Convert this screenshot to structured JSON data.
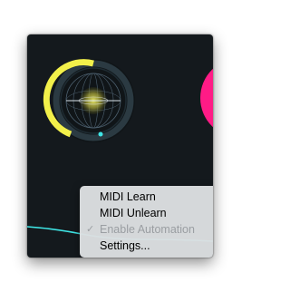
{
  "context_menu": {
    "items": [
      {
        "label": "MIDI Learn",
        "enabled": true,
        "checked": false
      },
      {
        "label": "MIDI Unlearn",
        "enabled": true,
        "checked": false
      },
      {
        "label": "Enable Automation",
        "enabled": false,
        "checked": true
      },
      {
        "label": "Settings...",
        "enabled": true,
        "checked": false
      }
    ],
    "check_glyph": "✓"
  },
  "colors": {
    "window_bg": "#14191d",
    "knob_accent": "#f2f04a",
    "knob_track": "#2b3a42",
    "side_control": "#ff1b86",
    "line": "#3fe6e6"
  }
}
